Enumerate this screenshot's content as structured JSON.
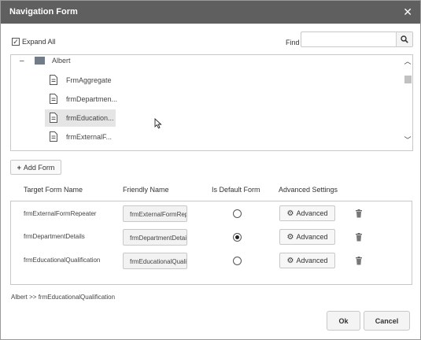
{
  "dialog": {
    "title": "Navigation Form",
    "close_icon": "close-icon"
  },
  "toolbar": {
    "expand_all_label": "Expand All",
    "expand_all_checked": true,
    "find_label": "Find",
    "find_value": "",
    "search_icon": "search-icon"
  },
  "tree": {
    "root": {
      "label": "Albert",
      "icon": "folder-icon",
      "expanded": true
    },
    "items": [
      {
        "label": "FrmAggregate",
        "icon": "document-icon"
      },
      {
        "label": "frmDepartmen...",
        "icon": "document-icon"
      },
      {
        "label": "frmEducation...",
        "icon": "document-icon",
        "selected": true
      },
      {
        "label": "frmExternalF...",
        "icon": "document-icon"
      }
    ]
  },
  "add_form_label": "Add Form",
  "grid": {
    "columns": [
      "Target Form Name",
      "Friendly Name",
      "Is Default Form",
      "Advanced Settings"
    ],
    "rows": [
      {
        "target": "frmExternalFormRepeater",
        "friendly": "frmExternalFormRep",
        "is_default": false,
        "advanced_label": "Advanced"
      },
      {
        "target": "frmDepartmentDetails",
        "friendly": "frmDepartmentDetai",
        "is_default": true,
        "advanced_label": "Advanced"
      },
      {
        "target": "frmEducationalQualification",
        "friendly": "frmEducationalQuali",
        "is_default": false,
        "advanced_label": "Advanced"
      }
    ]
  },
  "breadcrumb": "Albert >> frmEducationalQualification",
  "footer": {
    "ok_label": "Ok",
    "cancel_label": "Cancel"
  },
  "colors": {
    "titlebar": "#5f5f5f",
    "selection": "#e5e5e5",
    "border": "#c8c8c8"
  }
}
